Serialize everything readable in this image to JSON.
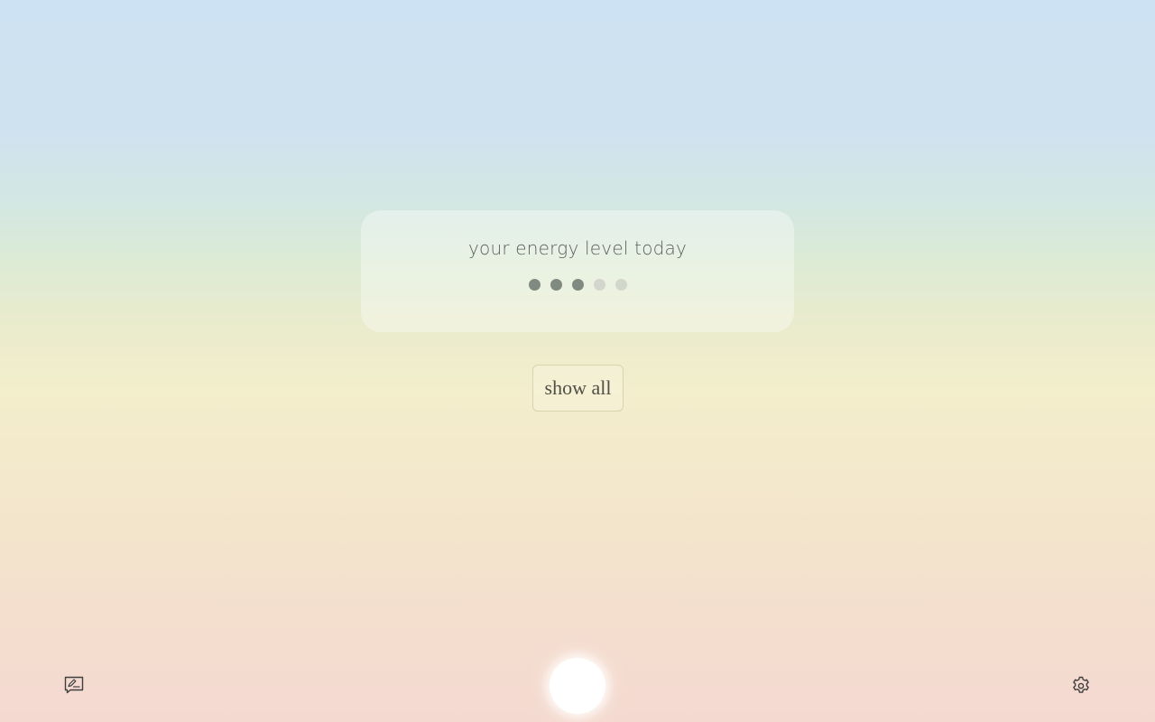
{
  "card": {
    "title": "your energy level today",
    "rating": {
      "max": 5,
      "value": 3
    }
  },
  "show_all_label": "show all",
  "icons": {
    "feedback": "feedback-icon",
    "settings": "gear-icon",
    "center": "orb-button"
  },
  "colors": {
    "dot_filled": "#818a80",
    "dot_empty": "#d2d6cd",
    "text": "#5b615d"
  }
}
